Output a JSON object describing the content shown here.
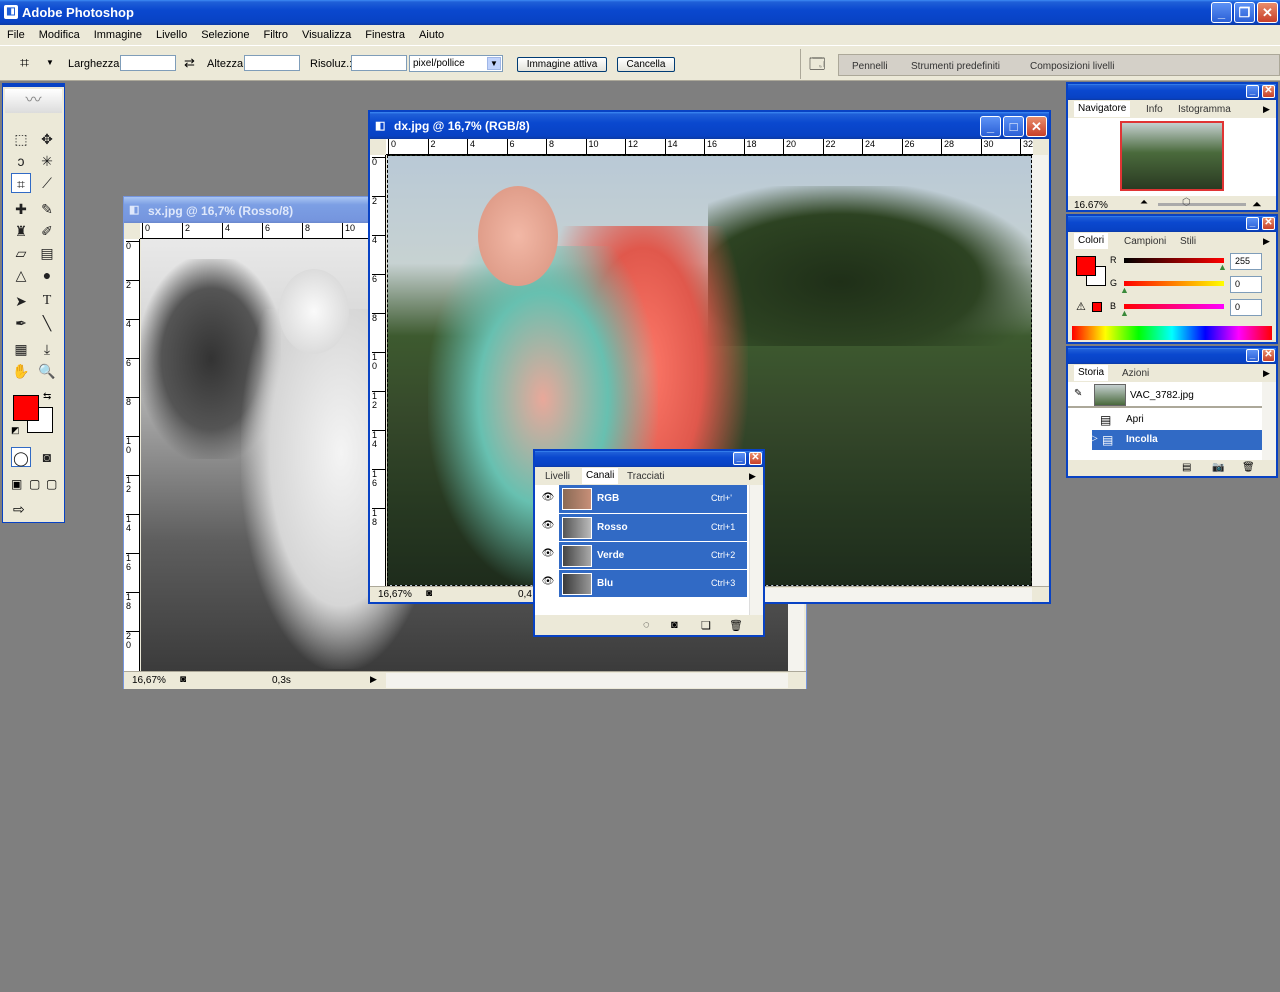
{
  "app": {
    "title": "Adobe Photoshop"
  },
  "menu": [
    "File",
    "Modifica",
    "Immagine",
    "Livello",
    "Selezione",
    "Filtro",
    "Visualizza",
    "Finestra",
    "Aiuto"
  ],
  "options": {
    "larghezza": "Larghezza:",
    "altezza": "Altezza:",
    "risoluz": "Risoluz.:",
    "unit": "pixel/pollice",
    "active_image": "Immagine attiva",
    "cancel": "Cancella"
  },
  "palette_well": [
    "Pennelli",
    "Strumenti predefiniti",
    "Composizioni livelli"
  ],
  "doc_sx": {
    "title": "sx.jpg @ 16,7% (Rosso/8)",
    "zoom": "16,67%",
    "status": "0,3s",
    "ruler": [
      "0",
      "2",
      "4",
      "6",
      "8",
      "10"
    ],
    "vruler": [
      "0",
      "2",
      "4",
      "6",
      "8",
      "1\n0",
      "1\n2",
      "1\n4",
      "1\n6",
      "1\n8",
      "2\n0"
    ]
  },
  "doc_dx": {
    "title": "dx.jpg @ 16,7% (RGB/8)",
    "zoom": "16,67%",
    "status": "0,4",
    "ruler": [
      "0",
      "2",
      "4",
      "6",
      "8",
      "10",
      "12",
      "14",
      "16",
      "18",
      "20",
      "22",
      "24",
      "26",
      "28",
      "30",
      "32"
    ],
    "vruler": [
      "0",
      "2",
      "4",
      "6",
      "8",
      "1\n0",
      "1\n2",
      "1\n4",
      "1\n6",
      "1\n8"
    ]
  },
  "navigator": {
    "tabs": [
      "Navigatore",
      "Info",
      "Istogramma"
    ],
    "zoom": "16.67%"
  },
  "colors": {
    "tabs": [
      "Colori",
      "Campioni",
      "Stili"
    ],
    "r": "255",
    "g": "0",
    "b": "0",
    "r_label": "R",
    "g_label": "G",
    "b_label": "B",
    "fg": "#ff0000",
    "bg": "#ffffff"
  },
  "history": {
    "tabs": [
      "Storia",
      "Azioni"
    ],
    "snapshot": "VAC_3782.jpg",
    "items": [
      "Apri",
      "Incolla"
    ]
  },
  "channels": {
    "tabs": [
      "Livelli",
      "Canali",
      "Tracciati"
    ],
    "rows": [
      {
        "name": "RGB",
        "key": "Ctrl+'"
      },
      {
        "name": "Rosso",
        "key": "Ctrl+1"
      },
      {
        "name": "Verde",
        "key": "Ctrl+2"
      },
      {
        "name": "Blu",
        "key": "Ctrl+3"
      }
    ]
  },
  "icons": {
    "minimize": "_",
    "maximize": "□",
    "close": "✕"
  }
}
